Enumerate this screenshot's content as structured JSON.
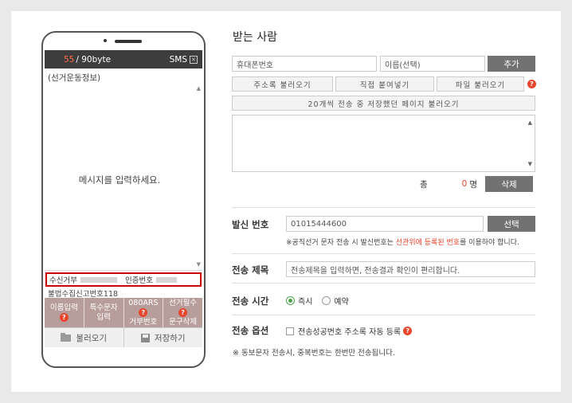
{
  "phone": {
    "count": "55",
    "limit": "/ 90byte",
    "sms_label": "SMS",
    "sms_close": "×",
    "header_text": "(선거운동정보)",
    "placeholder": "메시지를 입력하세요.",
    "reject_label": "수신거부",
    "auth_label": "인증번호",
    "free_line": "불법수집신고번호118",
    "buttons": [
      {
        "line1": "이름입력",
        "line2": ""
      },
      {
        "line1": "특수문자",
        "line2": "입력"
      },
      {
        "line1": "080ARS",
        "line2": "거부번호"
      },
      {
        "line1": "선거필수",
        "line2": "문구삭제"
      }
    ],
    "load_label": "불러오기",
    "save_label": "저장하기"
  },
  "recipients": {
    "title": "받는 사람",
    "phone_placeholder": "휴대폰번호",
    "name_placeholder": "이름(선택)",
    "add_label": "추가",
    "address_label": "주소록 불러오기",
    "direct_label": "직접 붙여넣기",
    "file_label": "파일 불러오기",
    "recent_label": "20개씩 전송 중 저장했던 페이지 불러오기",
    "total_label": "총",
    "total_count": "0",
    "unit": "명",
    "delete_label": "삭제"
  },
  "sender": {
    "label": "발신 번호",
    "number": "01015444600",
    "select_label": "선택",
    "note_pre": "※공직선거 문자 전송 시 발신번호는 ",
    "note_red": "선관위에 등록된 번호",
    "note_post": "를 이용하야 합니다."
  },
  "subject": {
    "label": "전송 제목",
    "placeholder": "전송제목을 입력하면, 전송결과 확인이 편리합니다."
  },
  "timing": {
    "label": "전송 시간",
    "now": "즉시",
    "reserve": "예약"
  },
  "options": {
    "label": "전송 옵션",
    "save_book": "전송성공번호 주소록 자동 등록",
    "note": "※ 동보문자 전송시, 중복번호는 한번만 전송됩니다."
  },
  "colors": {
    "accent": "#e8452c",
    "dark_button": "#727272",
    "phone_header": "#3d3d3d",
    "button_bar": "#b79e9a"
  }
}
